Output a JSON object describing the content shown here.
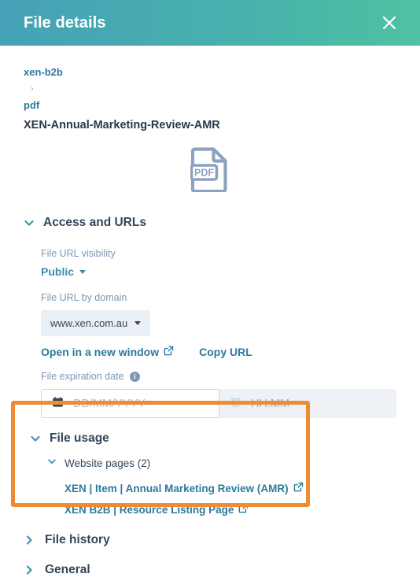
{
  "header": {
    "title": "File details",
    "close_icon": "close-icon",
    "gradient_from": "#45a1b7",
    "gradient_to": "#4ec2a2"
  },
  "breadcrumb": {
    "items": [
      "xen-b2b",
      "pdf"
    ],
    "separator": "›"
  },
  "file": {
    "name": "XEN-Annual-Marketing-Review-AMR",
    "type_icon": "pdf-file-icon",
    "type_label": "PDF"
  },
  "access_section": {
    "title": "Access and URLs",
    "expanded": true,
    "chevron_icon": "chevron-down-icon",
    "visibility_label": "File URL visibility",
    "visibility_value": "Public",
    "domain_label": "File URL by domain",
    "domain_value": "www.xen.com.au",
    "open_window_link": "Open in a new window",
    "open_window_icon": "external-link-icon",
    "copy_url_link": "Copy URL",
    "expiration_label": "File expiration date",
    "info_icon": "info-icon",
    "date_placeholder": "DD/MM/YYYY",
    "date_value": "",
    "date_icon": "calendar-icon",
    "time_placeholder": "HH:MM",
    "time_value": "",
    "time_icon": "clock-icon"
  },
  "usage_section": {
    "title": "File usage",
    "expanded": true,
    "chevron_icon": "chevron-down-icon",
    "highlight_color": "#ef8b33",
    "subsection_title": "Website pages (2)",
    "links": [
      {
        "label": "XEN | Item | Annual Marketing Review (AMR)",
        "icon": "external-link-icon"
      },
      {
        "label": "XEN B2B | Resource Listing Page",
        "icon": "external-link-icon"
      }
    ]
  },
  "collapsed_sections": [
    {
      "title": "File history",
      "chevron_icon": "chevron-right-icon"
    },
    {
      "title": "General",
      "chevron_icon": "chevron-right-icon"
    }
  ]
}
